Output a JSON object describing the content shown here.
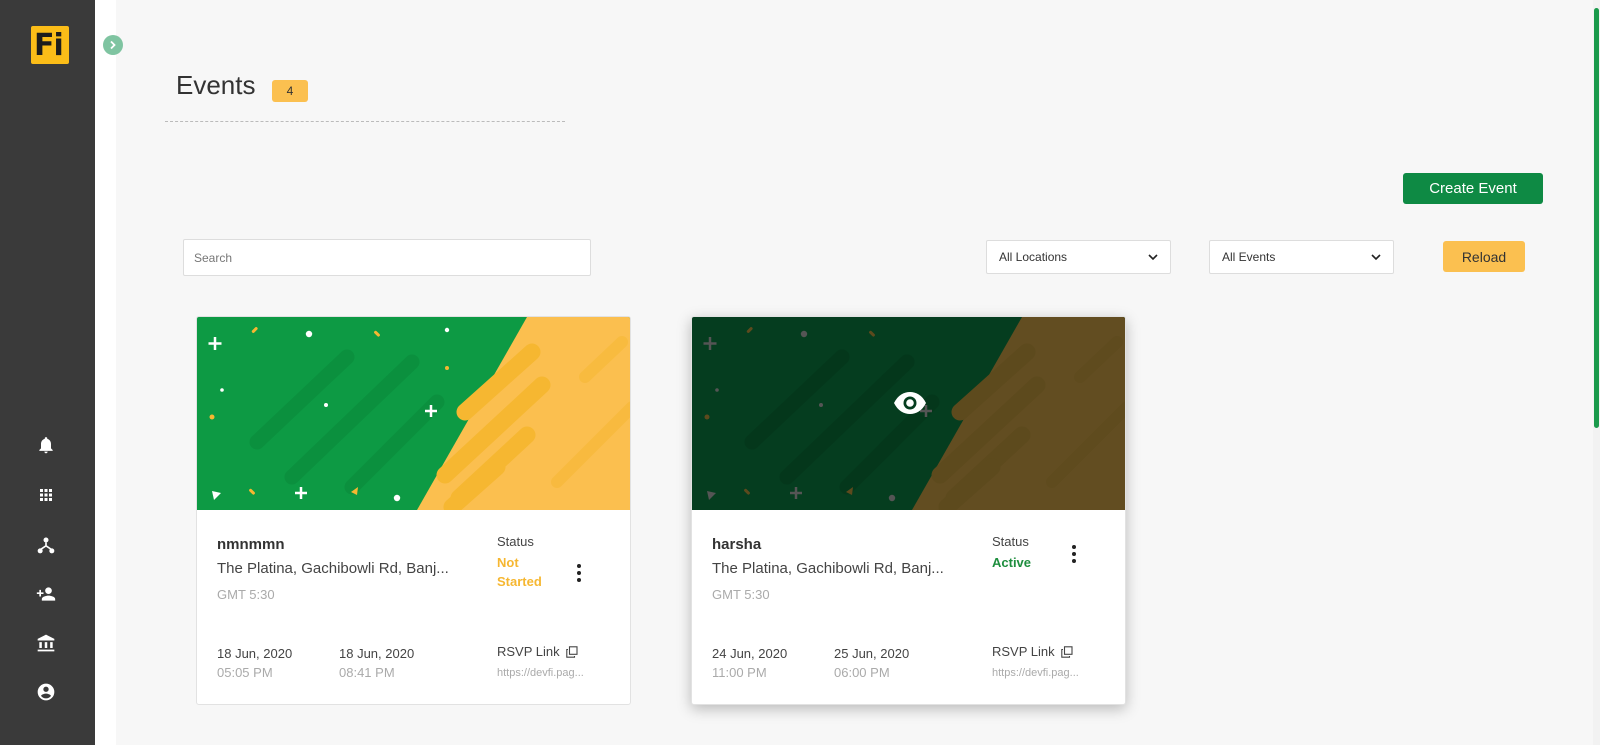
{
  "sidebar": {
    "logo_text": "Fi",
    "items": [
      {
        "icon": "bell-icon"
      },
      {
        "icon": "grid-icon"
      },
      {
        "icon": "network-icon"
      },
      {
        "icon": "add-user-icon"
      },
      {
        "icon": "bank-icon"
      },
      {
        "icon": "account-icon"
      }
    ]
  },
  "header": {
    "title": "Events",
    "count": "4"
  },
  "toolbar": {
    "create_label": "Create Event",
    "search_placeholder": "Search",
    "location_filter": "All Locations",
    "event_filter": "All Events",
    "reload_label": "Reload"
  },
  "events": [
    {
      "name": "nmnmmn",
      "address": "The Platina, Gachibowli Rd, Banj...",
      "timezone": "GMT 5:30",
      "status_label": "Status",
      "status": "Not Started",
      "status_color": "#f6b731",
      "start_date": "18 Jun, 2020",
      "start_time": "05:05 PM",
      "end_date": "18 Jun, 2020",
      "end_time": "08:41 PM",
      "rsvp_label": "RSVP Link",
      "rsvp_url": "https://devfi.pag..."
    },
    {
      "name": "harsha",
      "address": "The Platina, Gachibowli Rd, Banj...",
      "timezone": "GMT 5:30",
      "status_label": "Status",
      "status": "Active",
      "status_color": "#1e8e3e",
      "start_date": "24 Jun, 2020",
      "start_time": "11:00 PM",
      "end_date": "25 Jun, 2020",
      "end_time": "06:00 PM",
      "rsvp_label": "RSVP Link",
      "rsvp_url": "https://devfi.pag..."
    }
  ],
  "colors": {
    "brand_green": "#0e8a44",
    "accent_yellow": "#fbc050",
    "sidebar": "#3a3a3a"
  }
}
